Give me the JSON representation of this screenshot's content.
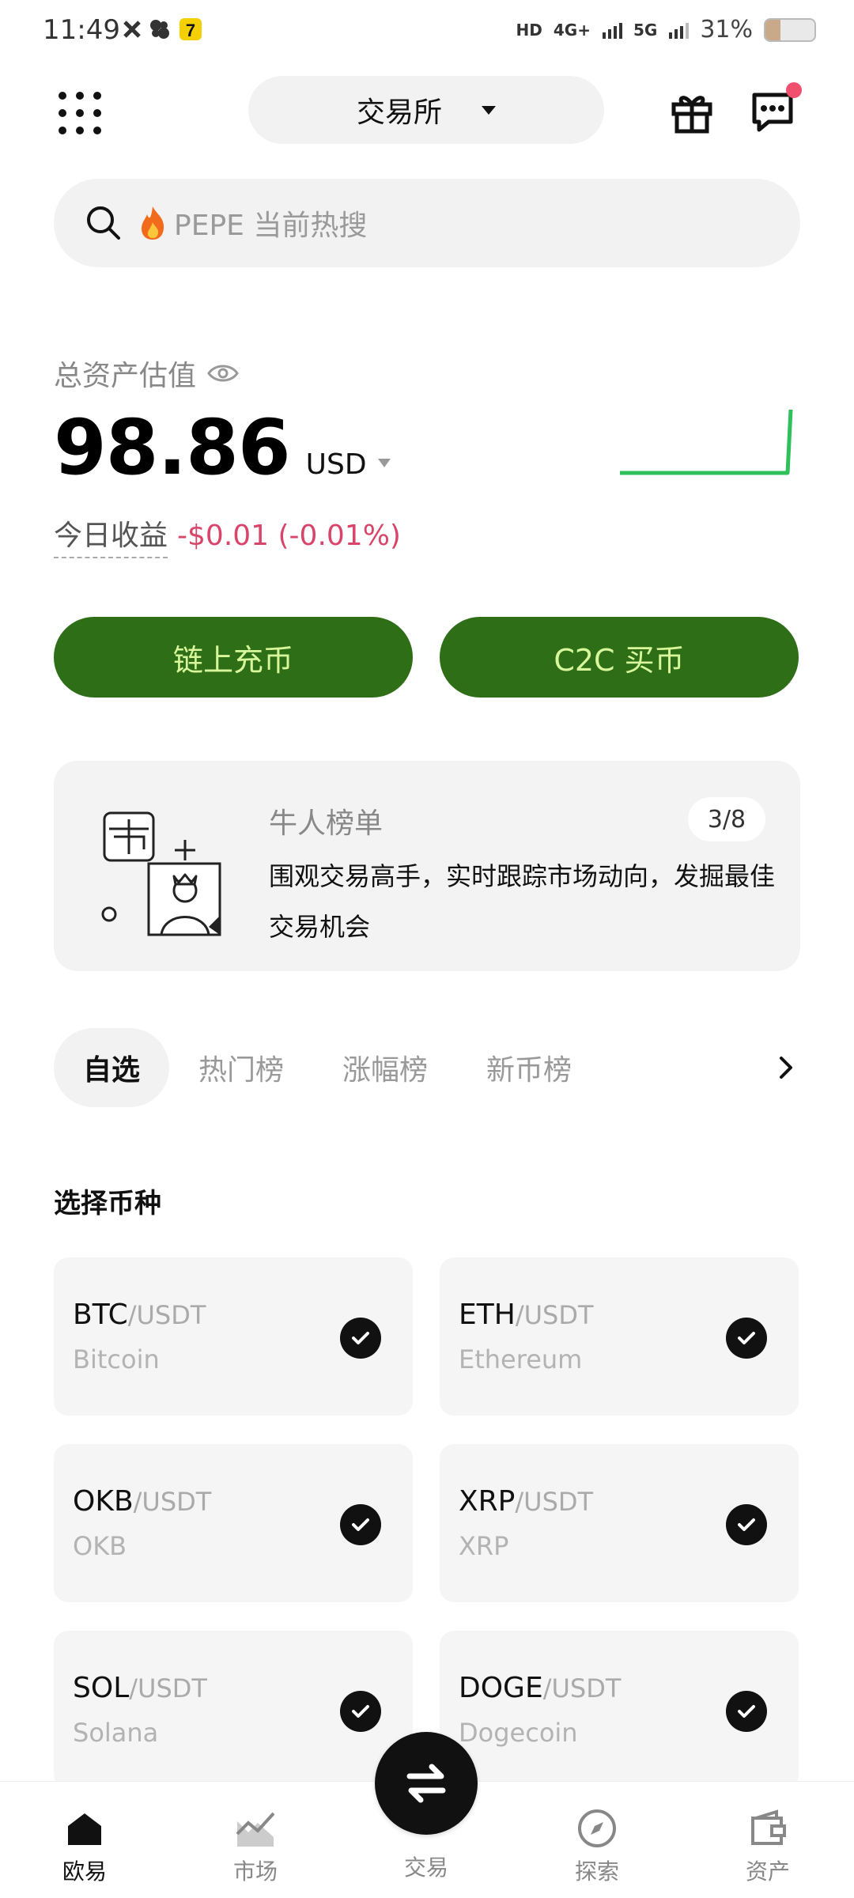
{
  "status_bar": {
    "time": "11:49",
    "net1": "HD",
    "net2": "4G+",
    "net3": "5G",
    "battery": "31%",
    "battery_level": 0.31
  },
  "header": {
    "exchange_label": "交易所"
  },
  "search": {
    "hot_text": "PEPE 当前热搜"
  },
  "assets": {
    "label": "总资产估值",
    "value": "98.86",
    "unit": "USD",
    "pnl_label": "今日收益",
    "pnl_value": "-$0.01 (-0.01%)",
    "pnl_color": "#d9456a",
    "sparkline_color": "#2ec05a"
  },
  "actions": {
    "deposit": "链上充币",
    "c2c": "C2C 买币",
    "button_bg": "#2d6e16",
    "button_text": "#d8f79b"
  },
  "leaderboard": {
    "title": "牛人榜单",
    "page": "3/8",
    "description": "围观交易高手，实时跟踪市场动向，发掘最佳交易机会"
  },
  "tabs": [
    "自选",
    "热门榜",
    "涨幅榜",
    "新币榜"
  ],
  "section_title": "选择币种",
  "coins": [
    {
      "symbol": "BTC",
      "quote": "/USDT",
      "name": "Bitcoin"
    },
    {
      "symbol": "ETH",
      "quote": "/USDT",
      "name": "Ethereum"
    },
    {
      "symbol": "OKB",
      "quote": "/USDT",
      "name": "OKB"
    },
    {
      "symbol": "XRP",
      "quote": "/USDT",
      "name": "XRP"
    },
    {
      "symbol": "SOL",
      "quote": "/USDT",
      "name": "Solana"
    },
    {
      "symbol": "DOGE",
      "quote": "/USDT",
      "name": "Dogecoin"
    }
  ],
  "nav": {
    "home": "欧易",
    "market": "市场",
    "trade": "交易",
    "explore": "探索",
    "assets": "资产"
  }
}
